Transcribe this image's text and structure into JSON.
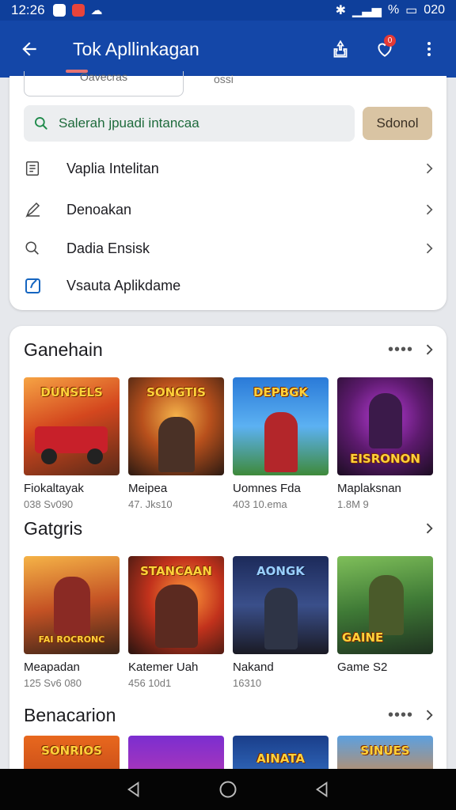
{
  "status": {
    "time": "12:26",
    "battery": "020",
    "signal_text": "%"
  },
  "appbar": {
    "title": "Tok Apllinkagan",
    "notif_count": "0"
  },
  "top_tabs": [
    {
      "label": "Oavecras"
    },
    {
      "label": "ossi"
    }
  ],
  "search": {
    "value": "Salerah jpuadi intancaa",
    "button_label": "Sdonol"
  },
  "menu": [
    {
      "label": "Vaplia Intelitan",
      "icon": "document-icon"
    },
    {
      "label": "Denoakan",
      "icon": "pen-icon"
    },
    {
      "label": "Dadia Ensisk",
      "icon": "search-icon"
    },
    {
      "label": "Vsauta Aplikdame",
      "icon": "edit-box-icon"
    }
  ],
  "sections": [
    {
      "title": "Ganehain",
      "more": "••••",
      "items": [
        {
          "name": "Fiokaltayak",
          "meta": "038 Sv090",
          "art": "DUNSELS"
        },
        {
          "name": "Meipea",
          "meta": "47. Jks10",
          "art": "SONGTIS"
        },
        {
          "name": "Uomnes Fda",
          "meta": "403 10.ema",
          "art": "DEPBGK"
        },
        {
          "name": "Maplaksnan",
          "meta": "1.8M 9",
          "art": "EISRONON"
        }
      ]
    },
    {
      "title": "Gatgris",
      "more": "",
      "items": [
        {
          "name": "Meapadan",
          "meta": "125 Sv6 080",
          "art": "FAI ROCRONC"
        },
        {
          "name": "Katemer Uah",
          "meta": "456 10d1",
          "art": "STANCAAN"
        },
        {
          "name": "Nakand",
          "meta": "16310",
          "art": "AONGK"
        },
        {
          "name": "Game S2",
          "meta": "",
          "art": "GAINE"
        }
      ]
    },
    {
      "title": "Benacarion",
      "more": "••••",
      "items": [
        {
          "name": "",
          "meta": "",
          "art": "SONRIOS"
        },
        {
          "name": "",
          "meta": "",
          "art": ""
        },
        {
          "name": "",
          "meta": "",
          "art": "AINATA"
        },
        {
          "name": "",
          "meta": "",
          "art": "SINUES"
        }
      ]
    }
  ],
  "colors": {
    "appbar": "#1447a8",
    "search_button": "#d9c4a3",
    "badge": "#e53935"
  }
}
